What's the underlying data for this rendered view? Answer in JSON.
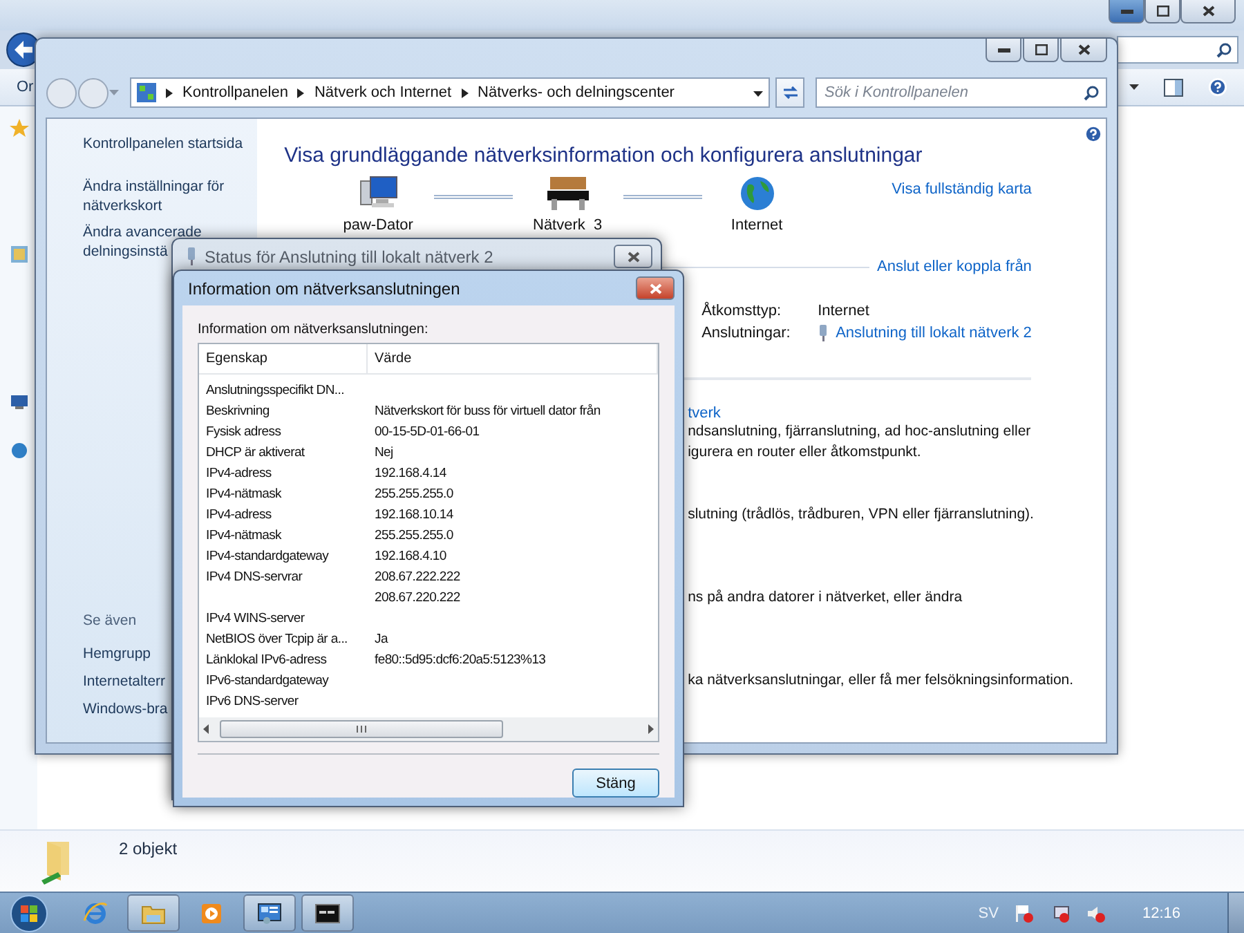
{
  "background_window": {
    "toolbar_text": "Or",
    "status_text": "2 objekt"
  },
  "control_panel": {
    "breadcrumb": [
      "Kontrollpanelen",
      "Nätverk och Internet",
      "Nätverks- och delningscenter"
    ],
    "search": {
      "placeholder": "Sök i Kontrollpanelen"
    },
    "sidebar": {
      "links": [
        {
          "lines": [
            "Kontrollpanelen startsida"
          ]
        },
        {
          "lines": [
            "Ändra inställningar för",
            "nätverkskort"
          ]
        },
        {
          "lines": [
            "Ändra avancerade",
            "delningsinstä"
          ]
        }
      ],
      "see_also_title": "Se även",
      "see_also": [
        "Hemgrupp",
        "Internetalterr",
        "Windows-bra"
      ]
    },
    "heading": "Visa grundläggande nätverksinformation och konfigurera anslutningar",
    "map_nodes": [
      {
        "kind": "computer",
        "label": "paw-Dator"
      },
      {
        "kind": "network",
        "label": "Nätverk  3"
      },
      {
        "kind": "internet",
        "label": "Internet"
      }
    ],
    "full_map_link": "Visa fullständig karta",
    "connect_link": "Anslut eller koppla från",
    "network_info": [
      {
        "kind": "text",
        "label": "Åtkomsttyp:",
        "value": "Internet"
      },
      {
        "kind": "link",
        "label": "Anslutningar:",
        "value": "Anslutning till lokalt nätverk 2"
      }
    ],
    "task_groups": [
      {
        "title": "tverk",
        "lines": [
          "ndsanslutning, fjärranslutning, ad hoc-anslutning eller",
          "igurera en router eller åtkomstpunkt."
        ]
      },
      {
        "lines": [
          "slutning (trådlös, trådburen, VPN eller fjärranslutning)."
        ]
      },
      {
        "lines": [
          "ns på andra datorer i nätverket, eller ändra"
        ]
      },
      {
        "lines": [
          "ka nätverksanslutningar, eller få mer felsökningsinformation."
        ]
      }
    ]
  },
  "status_dialog": {
    "title": "Status för Anslutning till lokalt nätverk 2"
  },
  "info_dialog": {
    "title": "Information om nätverksanslutningen",
    "label": "Information om nätverksanslutningen:",
    "columns": [
      "Egenskap",
      "Värde"
    ],
    "rows": [
      [
        "Anslutningsspecifikt DN...",
        ""
      ],
      [
        "Beskrivning",
        "Nätverkskort för buss för virtuell dator från"
      ],
      [
        "Fysisk adress",
        "00-15-5D-01-66-01"
      ],
      [
        "DHCP är aktiverat",
        "Nej"
      ],
      [
        "IPv4-adress",
        "192.168.4.14"
      ],
      [
        "IPv4-nätmask",
        "255.255.255.0"
      ],
      [
        "IPv4-adress",
        "192.168.10.14"
      ],
      [
        "IPv4-nätmask",
        "255.255.255.0"
      ],
      [
        "IPv4-standardgateway",
        "192.168.4.10"
      ],
      [
        "IPv4 DNS-servrar",
        "208.67.222.222"
      ],
      [
        "",
        "208.67.220.222"
      ],
      [
        "IPv4 WINS-server",
        ""
      ],
      [
        "NetBIOS över Tcpip är a...",
        "Ja"
      ],
      [
        "Länklokal IPv6-adress",
        "fe80::5d95:dcf6:20a5:5123%13"
      ],
      [
        "IPv6-standardgateway",
        ""
      ],
      [
        "IPv6 DNS-server",
        ""
      ]
    ],
    "button": "Stäng"
  },
  "taskbar": {
    "items": [
      {
        "kind": "ie",
        "open": false
      },
      {
        "kind": "explorer",
        "open": true
      },
      {
        "kind": "media",
        "open": false
      },
      {
        "kind": "control",
        "open": true
      },
      {
        "kind": "cmd",
        "open": true
      }
    ],
    "language": "SV",
    "clock": "12:16"
  }
}
